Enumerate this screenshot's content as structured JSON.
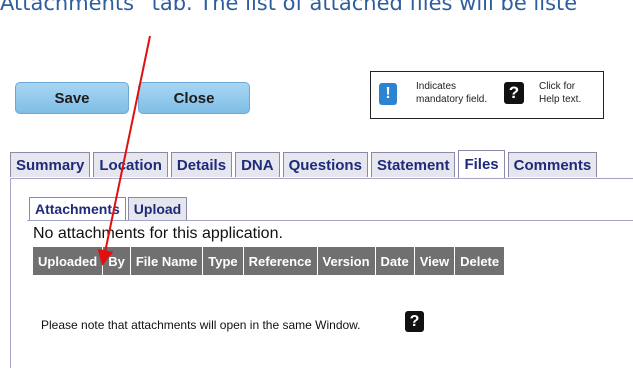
{
  "caption": "Attachments” tab. The list of attached files will be liste",
  "toolbar": {
    "save_label": "Save",
    "close_label": "Close"
  },
  "legend": {
    "mandatory_text_1": "Indicates",
    "mandatory_text_2": "mandatory field.",
    "mandatory_icon": "!",
    "help_icon": "?",
    "help_text_1": "Click for",
    "help_text_2": "Help text."
  },
  "tabs": [
    "Summary",
    "Location",
    "Details",
    "DNA",
    "Questions",
    "Statement",
    "Files",
    "Comments"
  ],
  "active_tab": "Files",
  "subtabs": [
    "Attachments",
    "Upload"
  ],
  "active_subtab": "Attachments",
  "attachments": {
    "empty_message": "No attachments for this application.",
    "columns": [
      "Uploaded",
      "By",
      "File Name",
      "Type",
      "Reference",
      "Version",
      "Date",
      "View",
      "Delete"
    ],
    "note": "Please note that attachments will open in the same Window.",
    "help_icon": "?"
  },
  "colors": {
    "annotation_arrow": "#e01010",
    "tab_text": "#1e2a7a",
    "header_bg": "#707070"
  },
  "icons": {
    "annotation": "red-arrow-icon"
  }
}
